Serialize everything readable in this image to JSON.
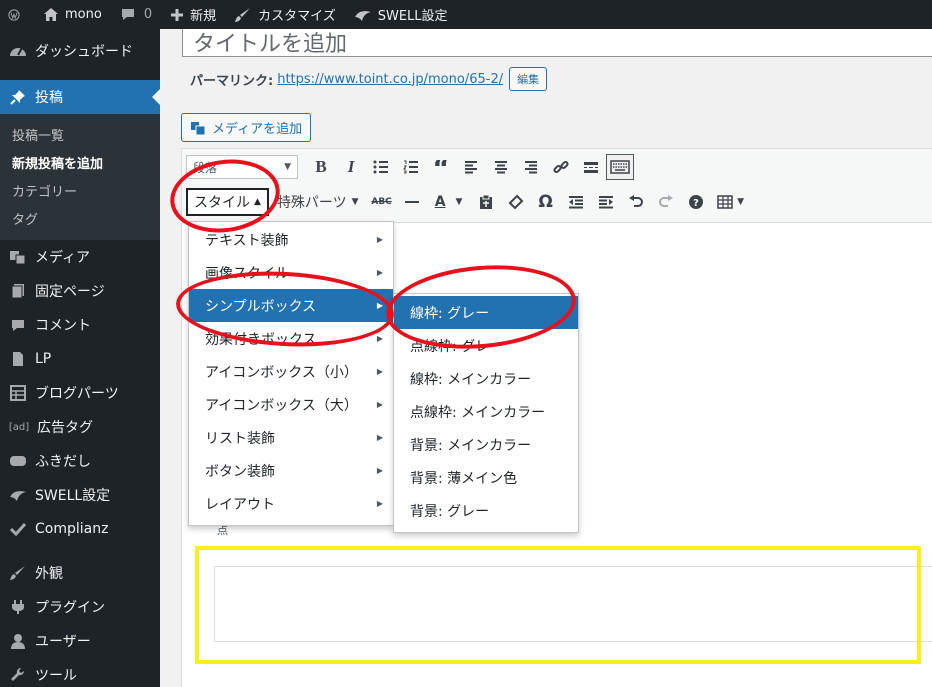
{
  "adminbar": {
    "site_name": "mono",
    "comments_count": "0",
    "new_label": "新規",
    "customize_label": "カスタマイズ",
    "swell_label": "SWELL設定"
  },
  "sidebar": {
    "items": [
      {
        "label": "ダッシュボード",
        "icon": "dashboard-icon"
      },
      {
        "label": "投稿",
        "icon": "pin-icon",
        "current": true
      },
      {
        "label": "メディア",
        "icon": "media-icon"
      },
      {
        "label": "固定ページ",
        "icon": "page-icon"
      },
      {
        "label": "コメント",
        "icon": "comment-icon"
      },
      {
        "label": "LP",
        "icon": "document-icon"
      },
      {
        "label": "ブログパーツ",
        "icon": "grid-icon"
      },
      {
        "label": "広告タグ",
        "icon": "ad-icon"
      },
      {
        "label": "ふきだし",
        "icon": "balloon-icon"
      },
      {
        "label": "SWELL設定",
        "icon": "swell-icon"
      },
      {
        "label": "Complianz",
        "icon": "check-icon"
      },
      {
        "label": "外観",
        "icon": "brush-icon"
      },
      {
        "label": "プラグイン",
        "icon": "plugin-icon"
      },
      {
        "label": "ユーザー",
        "icon": "user-icon"
      },
      {
        "label": "ツール",
        "icon": "tool-icon"
      }
    ],
    "submenu": [
      "投稿一覧",
      "新規投稿を追加",
      "カテゴリー",
      "タグ"
    ]
  },
  "editor": {
    "title_placeholder": "タイトルを追加",
    "permalink_label": "パーマリンク:",
    "permalink_url": "https://www.toint.co.jp/mono/65-2/",
    "permalink_edit": "編集",
    "add_media": "メディアを追加",
    "format_select": "段落",
    "style_button": "スタイル",
    "special_parts": "特殊パーツ",
    "bullet_text": "点"
  },
  "style_menu": [
    "テキスト装飾",
    "画像スタイル",
    "シンプルボックス",
    "効果付きボックス",
    "アイコンボックス（小）",
    "アイコンボックス（大）",
    "リスト装飾",
    "ボタン装飾",
    "レイアウト"
  ],
  "simple_box_menu": [
    "線枠: グレー",
    "点線枠: グレー",
    "線枠: メインカラー",
    "点線枠: メインカラー",
    "背景: メインカラー",
    "背景: 薄メイン色",
    "背景: グレー"
  ],
  "colors": {
    "accent": "#2271b1",
    "sidebar": "#1d2327",
    "annotation_red": "#e8101a",
    "annotation_yellow": "#f9ef1a"
  }
}
